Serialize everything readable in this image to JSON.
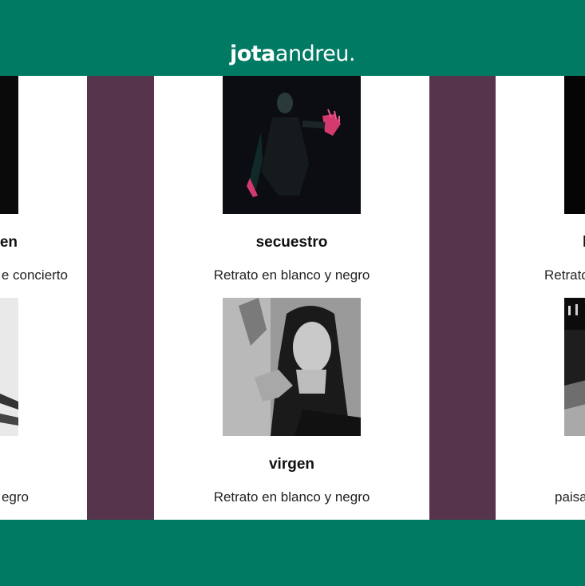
{
  "site": {
    "logo_bold": "jota",
    "logo_light": "andreu",
    "logo_dot": "."
  },
  "colors": {
    "brand_green": "#007a63",
    "stripe_plum": "#55344c",
    "panel_white": "#ffffff"
  },
  "left_column": {
    "items": [
      {
        "title": "en",
        "description": "e concierto",
        "photo": "dark-portrait-photo"
      },
      {
        "title": "",
        "description": "egro",
        "photo": "bw-portrait-photo"
      }
    ]
  },
  "center_column": {
    "items": [
      {
        "title": "secuestro",
        "description": "Retrato en blanco y negro",
        "photo": "neon-figure-photo"
      },
      {
        "title": "virgen",
        "description": "Retrato en blanco y negro",
        "photo": "bw-woman-portrait-photo"
      }
    ]
  },
  "right_column": {
    "items": [
      {
        "title": "l",
        "description": "Retrato",
        "photo": "dark-photo"
      },
      {
        "title": "",
        "description": "paisa",
        "photo": "bw-street-photo"
      }
    ]
  }
}
